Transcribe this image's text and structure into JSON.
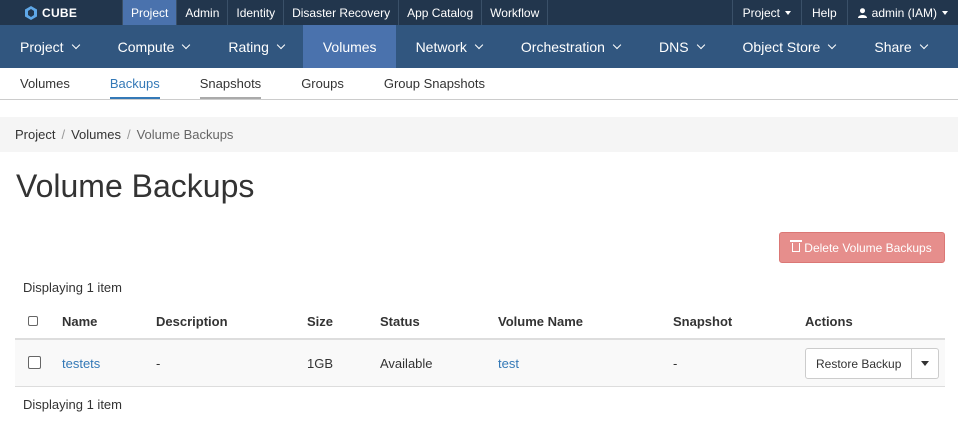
{
  "brand": {
    "name": "CUBE"
  },
  "topnav": [
    "Project",
    "Admin",
    "Identity",
    "Disaster Recovery",
    "App Catalog",
    "Workflow"
  ],
  "topnav_active": "Project",
  "topright": {
    "project": "Project",
    "help": "Help",
    "user": "admin (IAM)"
  },
  "secnav": [
    "Project",
    "Compute",
    "Rating",
    "Volumes",
    "Network",
    "Orchestration",
    "DNS",
    "Object Store",
    "Share"
  ],
  "secnav_active": "Volumes",
  "tabs": [
    "Volumes",
    "Backups",
    "Snapshots",
    "Groups",
    "Group Snapshots"
  ],
  "tabs_active": "Backups",
  "breadcrumb": {
    "item1": "Project",
    "item2": "Volumes",
    "current": "Volume Backups",
    "separator": "/"
  },
  "page_title": "Volume Backups",
  "delete_button": "Delete Volume Backups",
  "displaying_top": "Displaying 1 item",
  "displaying_bottom": "Displaying 1 item",
  "table": {
    "headers": {
      "name": "Name",
      "description": "Description",
      "size": "Size",
      "status": "Status",
      "volume_name": "Volume Name",
      "snapshot": "Snapshot",
      "actions": "Actions"
    },
    "rows": [
      {
        "name": "testets",
        "description": "-",
        "size": "1GB",
        "status": "Available",
        "volume_name": "test",
        "snapshot": "-",
        "action": "Restore Backup"
      }
    ]
  },
  "colors": {
    "topbar": "#22364d",
    "secnav": "#31567f",
    "active": "#4a72ad",
    "link": "#3479b7",
    "danger": "#d9534f"
  }
}
